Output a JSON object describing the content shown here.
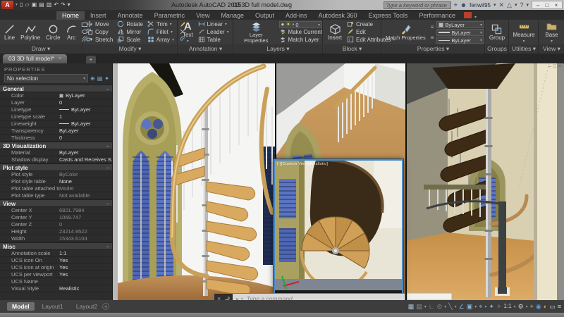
{
  "window": {
    "app_title": "Autodesk AutoCAD 2015",
    "doc_title": "03 3D full model.dwg",
    "search_placeholder": "Type a keyword or phrase",
    "username": "fenwit95",
    "file_tab": "03 3D full model*",
    "qat_icons": [
      {
        "name": "new-file-icon",
        "glyph": "▯"
      },
      {
        "name": "open-file-icon",
        "glyph": "▱"
      },
      {
        "name": "save-icon",
        "glyph": "▣"
      },
      {
        "name": "save-as-icon",
        "glyph": "▤"
      },
      {
        "name": "print-icon",
        "glyph": "▥"
      },
      {
        "name": "undo-icon",
        "glyph": "↶"
      },
      {
        "name": "redo-icon",
        "glyph": "↷"
      },
      {
        "name": "qat-dropdown-icon",
        "glyph": "▾"
      }
    ],
    "controls": [
      {
        "name": "minimize-button",
        "glyph": "–"
      },
      {
        "name": "restore-button",
        "glyph": "□"
      },
      {
        "name": "close-button",
        "glyph": "×"
      }
    ]
  },
  "ribbon": {
    "tabs": [
      {
        "label": "Home",
        "active": true
      },
      {
        "label": "Insert"
      },
      {
        "label": "Annotate"
      },
      {
        "label": "Parametric"
      },
      {
        "label": "View"
      },
      {
        "label": "Manage"
      },
      {
        "label": "Output"
      },
      {
        "label": "Add-ins"
      },
      {
        "label": "Autodesk 360"
      },
      {
        "label": "Express Tools"
      },
      {
        "label": "Performance"
      }
    ],
    "panels": {
      "draw": {
        "label": "Draw",
        "buttons": [
          "Line",
          "Polyline",
          "Circle",
          "Arc"
        ]
      },
      "modify": {
        "label": "Modify",
        "grid": [
          [
            "Move",
            "Rotate",
            "Trim"
          ],
          [
            "Copy",
            "Mirror",
            "Fillet"
          ],
          [
            "Stretch",
            "Scale",
            "Array"
          ]
        ]
      },
      "annotation": {
        "label": "Annotation",
        "big": "Text",
        "items": [
          "Linear",
          "Leader",
          "Table"
        ]
      },
      "layers": {
        "label": "Layers",
        "big": "Layer Properties",
        "layer_value": "0",
        "items": [
          "Make Current",
          "Match Layer"
        ]
      },
      "block": {
        "label": "Block",
        "big": "Insert",
        "items": [
          "Create",
          "Edit",
          "Edit Attributes"
        ]
      },
      "properties": {
        "label": "Properties",
        "big": "Match Properties",
        "dropdowns": [
          "ByLayer",
          "ByLayer",
          "ByLayer"
        ]
      },
      "groups": {
        "label": "Groups",
        "big": "Group"
      },
      "utilities": {
        "label": "Utilities",
        "big": "Measure"
      },
      "view": {
        "label": "View",
        "big": "Base"
      }
    }
  },
  "palette": {
    "title": "PROPERTIES",
    "selector": "No selection",
    "sections": [
      {
        "header": "General",
        "rows": [
          {
            "label": "Color",
            "value": "ByLayer",
            "prefix": "swatch"
          },
          {
            "label": "Layer",
            "value": "0"
          },
          {
            "label": "Linetype",
            "value": "ByLayer",
            "prefix": "line"
          },
          {
            "label": "Linetype scale",
            "value": "1"
          },
          {
            "label": "Lineweight",
            "value": "ByLayer",
            "prefix": "line"
          },
          {
            "label": "Transparency",
            "value": "ByLayer"
          },
          {
            "label": "Thickness",
            "value": "0"
          }
        ]
      },
      {
        "header": "3D Visualization",
        "rows": [
          {
            "label": "Material",
            "value": "ByLayer"
          },
          {
            "label": "Shadow display",
            "value": "Casts and Receives S..."
          }
        ]
      },
      {
        "header": "Plot style",
        "rows": [
          {
            "label": "Plot style",
            "value": "ByColor",
            "muted": true
          },
          {
            "label": "Plot style table",
            "value": "None"
          },
          {
            "label": "Plot table attached to",
            "value": "Model",
            "muted": true
          },
          {
            "label": "Plot table type",
            "value": "Not available",
            "muted": true
          }
        ]
      },
      {
        "header": "View",
        "rows": [
          {
            "label": "Center X",
            "value": "6821.7984",
            "muted": true
          },
          {
            "label": "Center Y",
            "value": "1069.747",
            "muted": true
          },
          {
            "label": "Center Z",
            "value": "0",
            "muted": true
          },
          {
            "label": "Height",
            "value": "23214.9522",
            "muted": true
          },
          {
            "label": "Width",
            "value": "15343.6104",
            "muted": true
          }
        ]
      },
      {
        "header": "Misc",
        "rows": [
          {
            "label": "Annotation scale",
            "value": "1:1"
          },
          {
            "label": "UCS icon On",
            "value": "Yes"
          },
          {
            "label": "UCS icon at origin",
            "value": "Yes"
          },
          {
            "label": "UCS per viewport",
            "value": "Yes"
          },
          {
            "label": "UCS Name",
            "value": ""
          },
          {
            "label": "Visual Style",
            "value": "Realistic"
          }
        ]
      }
    ]
  },
  "statusbar": {
    "model_tabs": [
      {
        "label": "Model",
        "active": true
      },
      {
        "label": "Layout1"
      },
      {
        "label": "Layout2"
      }
    ],
    "icons": [
      {
        "name": "grid-display-icon",
        "glyph": "▦",
        "color": "#9fc0d8"
      },
      {
        "name": "snap-mode-icon",
        "glyph": "▤",
        "color": "#8a8a8a",
        "caret": true
      },
      {
        "name": "ortho-icon",
        "glyph": "∟",
        "color": "#9a9a9a"
      },
      {
        "name": "polar-tracking-icon",
        "glyph": "⊙",
        "color": "#9a9a9a",
        "caret": true
      },
      {
        "name": "isodraft-icon",
        "glyph": "╲",
        "color": "#9a9a9a",
        "caret": true
      },
      {
        "name": "osnap-tracking-icon",
        "glyph": "∠",
        "color": "#7fb2d8"
      },
      {
        "name": "object-snap-icon",
        "glyph": "▣",
        "color": "#7fb2d8",
        "caret": true
      },
      {
        "name": "dynamic-input-icon",
        "glyph": "⌖",
        "color": "#7fb2d8",
        "caret": true
      },
      {
        "name": "annotation-visibility-icon",
        "glyph": "✦",
        "color": "#7fb2d8"
      },
      {
        "name": "annotation-autoscale-icon",
        "glyph": "✧",
        "color": "#9a9a9a"
      },
      {
        "name": "annotation-scale-label",
        "glyph": "1:1",
        "color": "#cccccc",
        "caret": true,
        "label": true
      },
      {
        "name": "workspace-icon",
        "glyph": "⚙",
        "color": "#cccccc",
        "caret": true
      },
      {
        "name": "customization-icon",
        "glyph": "+",
        "color": "#cccccc"
      },
      {
        "name": "isolate-objects-icon",
        "glyph": "◉",
        "color": "#5b9bd5"
      },
      {
        "name": "graphics-performance-icon",
        "glyph": "◐",
        "color": "#c8a050"
      },
      {
        "name": "clean-screen-icon",
        "glyph": "▭",
        "color": "#cccccc"
      },
      {
        "name": "menu-icon",
        "glyph": "≡",
        "color": "#cccccc"
      }
    ]
  },
  "command_line": {
    "placeholder": "Type a command"
  },
  "viewport_overlay": {
    "controls": "[-][Custom View][Realistic]"
  },
  "colors": {
    "ribbon_bg": "#3b3b3b",
    "palette_bg": "#2c2c2c",
    "status_bg": "#3d3d3d",
    "accent_blue": "#4689c8",
    "wood": "#c89a5a",
    "glass_blue": "#5b74c4",
    "frame_olive": "#a9a061"
  }
}
